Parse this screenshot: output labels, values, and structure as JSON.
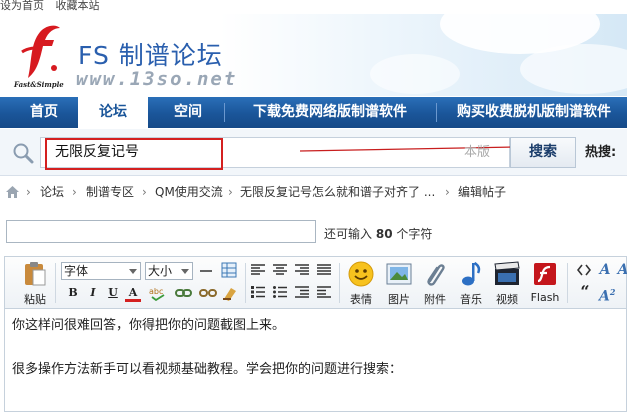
{
  "toplinks": {
    "set_home": "设为首页",
    "bookmark": "收藏本站"
  },
  "header": {
    "logo_small": "Fast&Simple",
    "site_title": "FS 制谱论坛",
    "site_url": "www.13so.net"
  },
  "nav": {
    "items": [
      {
        "label": "首页",
        "active": false
      },
      {
        "label": "论坛",
        "active": true
      },
      {
        "label": "空间",
        "active": false
      },
      {
        "label": "下载免费网络版制谱软件",
        "active": false
      },
      {
        "label": "购买收费脱机版制谱软件",
        "active": false
      }
    ]
  },
  "search": {
    "value": "无限反复记号",
    "scope": "本版",
    "button": "搜索",
    "hot_label": "热搜:"
  },
  "breadcrumb": {
    "items": [
      "论坛",
      "制谱专区",
      "QM使用交流",
      "无限反复记号怎么就和谱子对齐了 ...",
      "编辑帖子"
    ],
    "sep": "›"
  },
  "title_field": {
    "remaining_prefix": "还可输入",
    "remaining_count": "80",
    "remaining_suffix": "个字符"
  },
  "toolbar": {
    "paste": "粘贴",
    "font": "字体",
    "size": "大小",
    "bold": "B",
    "italic": "I",
    "underline": "U",
    "fontcolor": "A",
    "emoticon": "表情",
    "image": "图片",
    "attach": "附件",
    "music": "音乐",
    "video": "视频",
    "flash": "Flash",
    "quote": "“"
  },
  "editor": {
    "line1": "你这样问很难回答，你得把你的问题截图上来。",
    "line2": "很多操作方法新手可以看视频基础教程。学会把你的问题进行搜索："
  },
  "colors": {
    "nav_bg": "#1a5599",
    "title_blue": "#2a5fae",
    "highlight_red": "#d42020",
    "logo_red": "#d71a20"
  }
}
